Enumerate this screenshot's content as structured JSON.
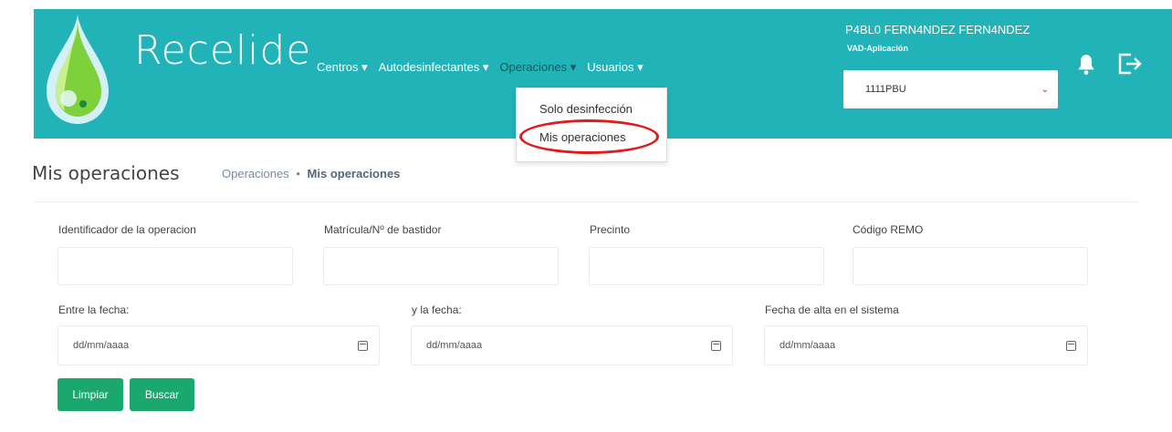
{
  "app": {
    "brand": "Recelide"
  },
  "nav": {
    "items": [
      {
        "label": "Centros ▾"
      },
      {
        "label": "Autodesinfectantes ▾"
      },
      {
        "label": "Operaciones ▾"
      },
      {
        "label": "Usuarios ▾"
      }
    ]
  },
  "user": {
    "name": "P4BL0 FERN4NDEZ FERN4NDEZ",
    "role": "VAD-Aplicación"
  },
  "vehicle_select": {
    "value": "1111PBU"
  },
  "dropdown": {
    "items": [
      {
        "label": "Solo desinfección"
      },
      {
        "label": "Mis operaciones"
      }
    ]
  },
  "page": {
    "title": "Mis operaciones"
  },
  "breadcrumb": {
    "parent": "Operaciones",
    "separator": "•",
    "current": "Mis operaciones"
  },
  "filters": {
    "operation_id": {
      "label": "Identificador de la operacion",
      "value": ""
    },
    "plate": {
      "label": "Matrícula/Nº de bastidor",
      "value": ""
    },
    "seal": {
      "label": "Precinto",
      "value": ""
    },
    "remo": {
      "label": "Código REMO",
      "value": ""
    },
    "date_from": {
      "label": "Entre la fecha:",
      "placeholder": "dd/mm/aaaa"
    },
    "date_to": {
      "label": "y la fecha:",
      "placeholder": "dd/mm/aaaa"
    },
    "date_created": {
      "label": "Fecha de alta en el sistema",
      "placeholder": "dd/mm/aaaa"
    }
  },
  "actions": {
    "clear_label": "Limpiar",
    "search_label": "Buscar"
  },
  "colors": {
    "header": "#22b3b8",
    "button": "#1aa86e",
    "highlight": "#e01b1b"
  },
  "icons": {
    "bell": "bell-icon",
    "logout": "logout-icon",
    "calendar": "calendar-icon",
    "logo": "drop-logo"
  }
}
